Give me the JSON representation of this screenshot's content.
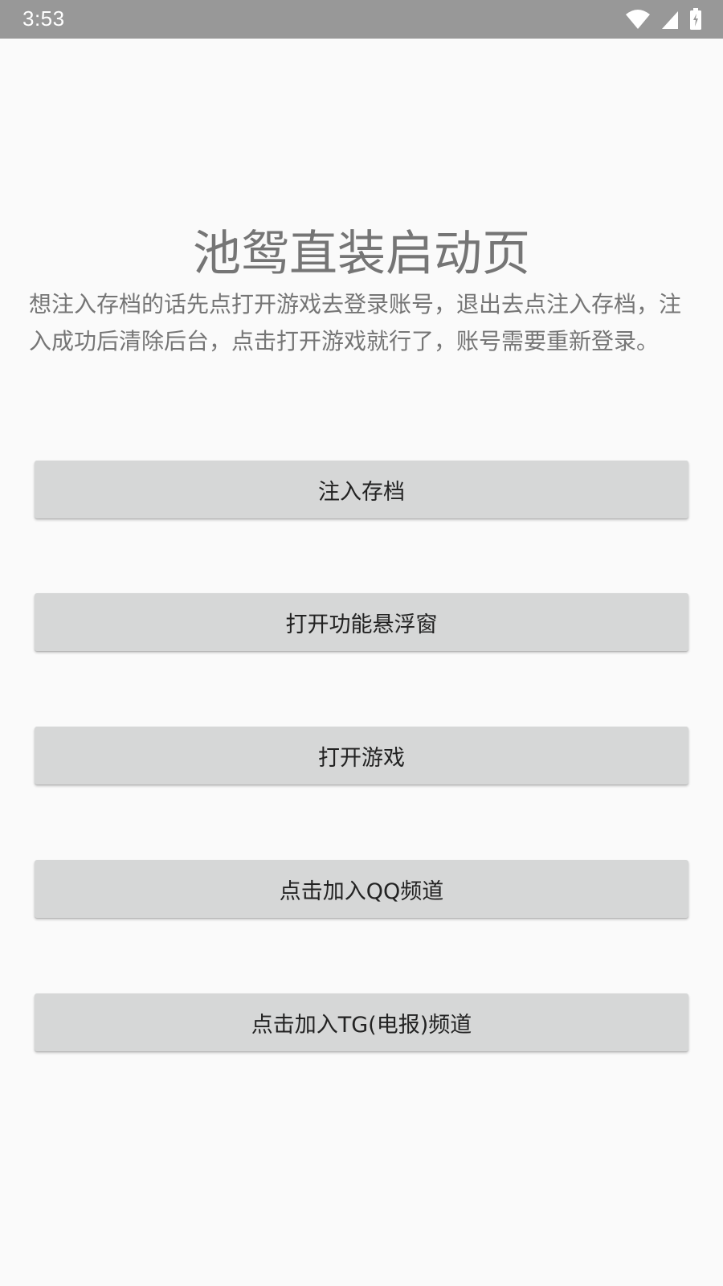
{
  "status_bar": {
    "time": "3:53",
    "icons": [
      "wifi-icon",
      "cell-signal-icon",
      "battery-charging-icon"
    ]
  },
  "main": {
    "title": "池鸳直装启动页",
    "description": "想注入存档的话先点打开游戏去登录账号，退出去点注入存档，注入成功后清除后台，点击打开游戏就行了，账号需要重新登录。",
    "buttons": [
      {
        "label": "注入存档"
      },
      {
        "label": "打开功能悬浮窗"
      },
      {
        "label": "打开游戏"
      },
      {
        "label": "点击加入QQ频道"
      },
      {
        "label": "点击加入TG(电报)频道"
      }
    ]
  },
  "colors": {
    "status_bar_bg": "#989898",
    "background": "#fafafa",
    "button_bg": "#d6d7d7",
    "title_text": "#757575",
    "button_text": "#222222"
  }
}
